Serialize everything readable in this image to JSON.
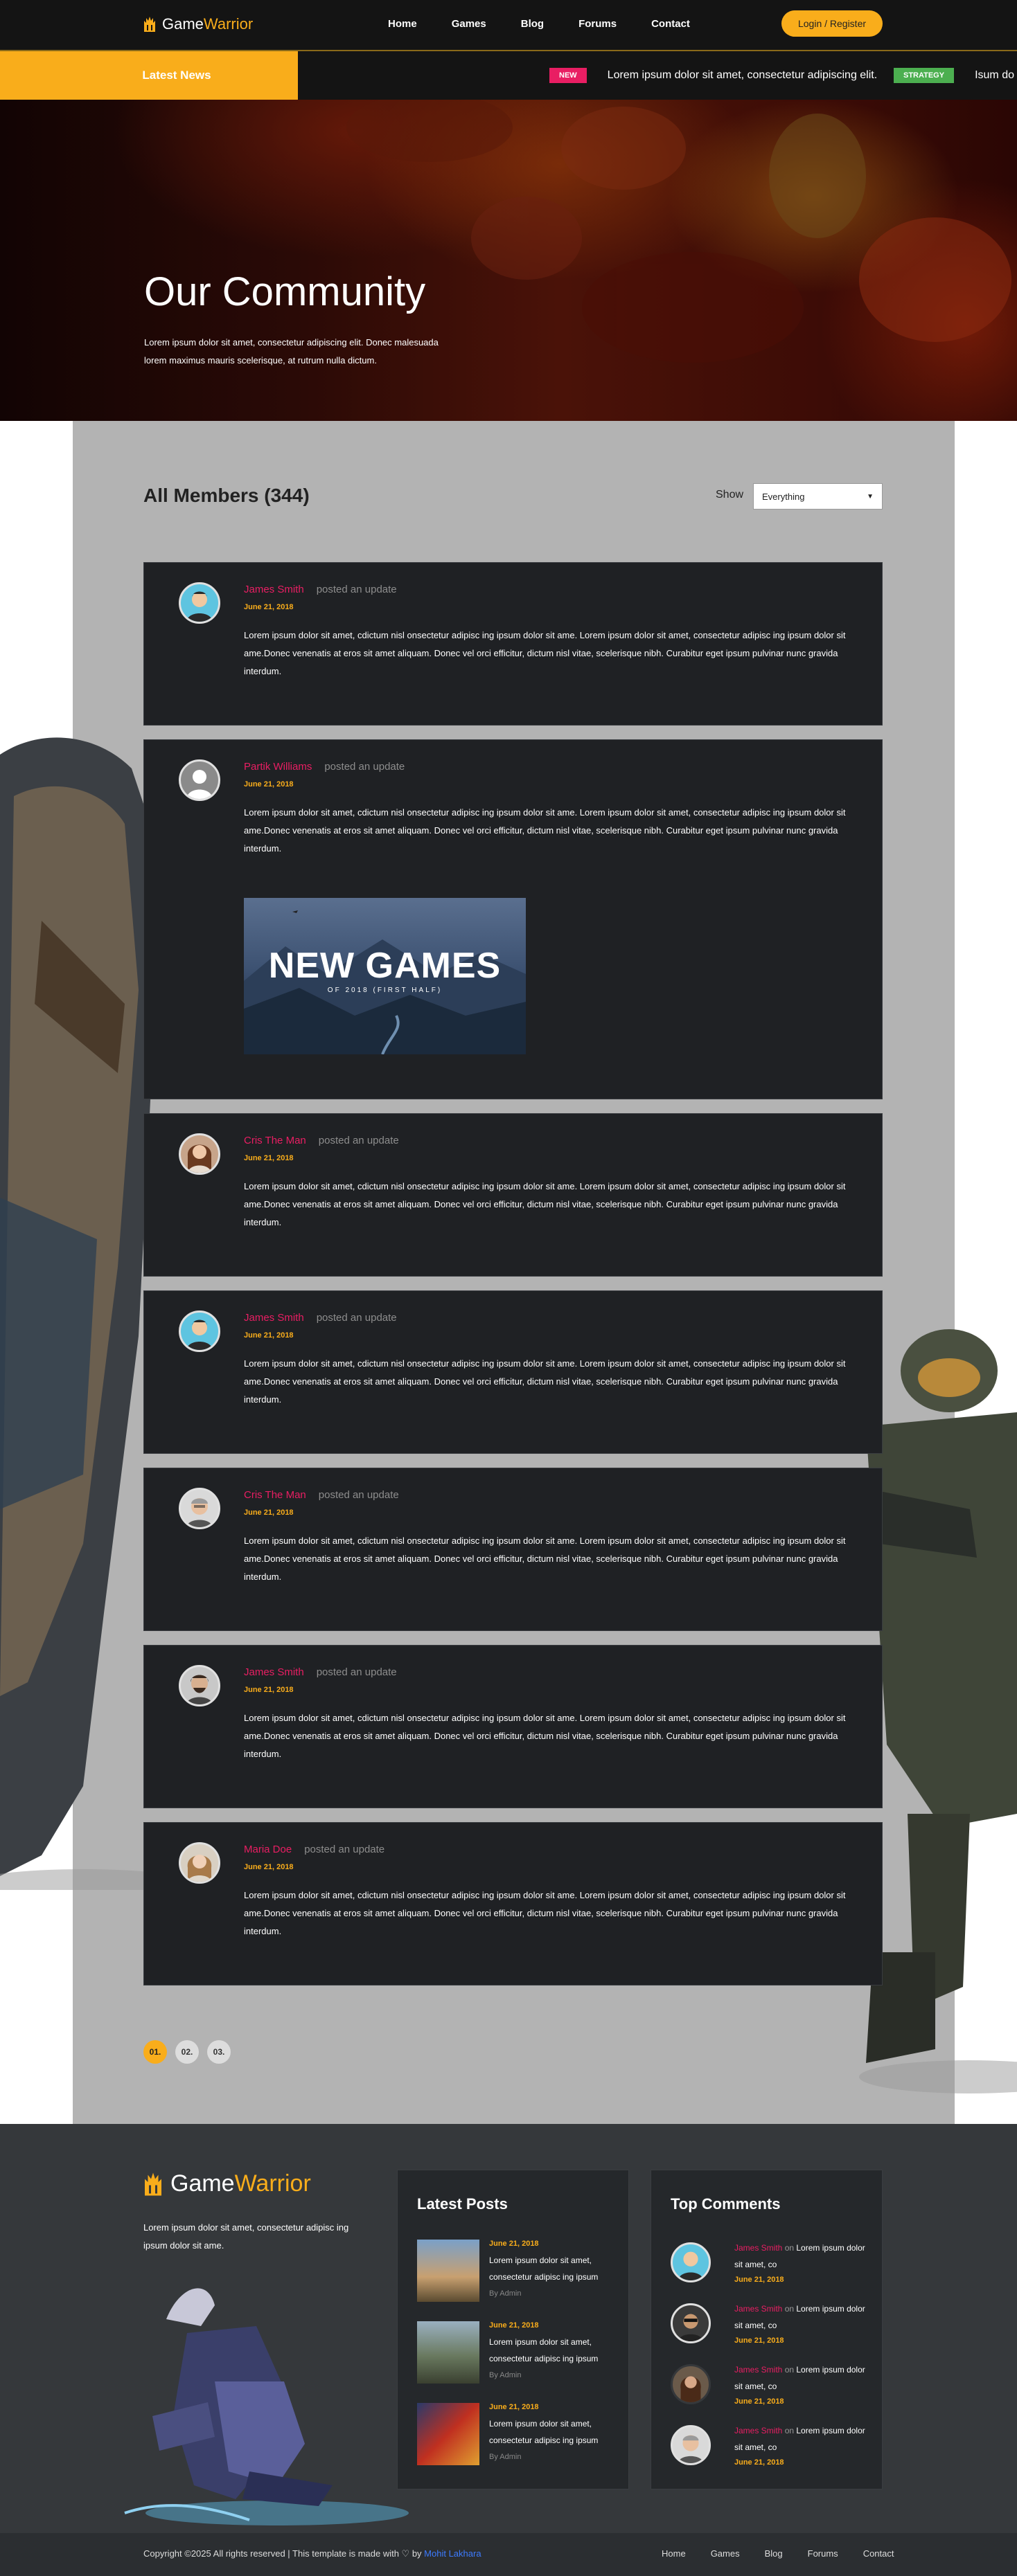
{
  "header": {
    "logo_main": "Game ",
    "logo_accent": "Warrior",
    "nav": [
      "Home",
      "Games",
      "Blog",
      "Forums",
      "Contact"
    ],
    "login_label": "Login / Register"
  },
  "ticker": {
    "label": "Latest News",
    "items": [
      {
        "tag": "NEW",
        "text": "Lorem ipsum dolor sit amet, consectetur adipiscing elit."
      },
      {
        "tag": "STRATEGY",
        "text": "Isum do"
      }
    ]
  },
  "hero": {
    "title": "Our Community",
    "text": "Lorem ipsum dolor sit amet, consectetur adipiscing elit. Donec malesuada lorem maximus mauris scelerisque, at rutrum nulla dictum."
  },
  "members": {
    "title": "All Members (344)",
    "show_label": "Show",
    "show_value": "Everything"
  },
  "posts": [
    {
      "name": "James Smith",
      "action": "posted an update",
      "date": "June 21, 2018",
      "text": "Lorem ipsum dolor sit amet, cdictum nisl onsectetur adipisc ing ipsum dolor sit ame. Lorem ipsum dolor sit amet, consectetur adipisc ing ipsum dolor sit ame.Donec venenatis at eros sit amet aliquam. Donec vel orci efficitur, dictum nisl vitae, scelerisque nibh. Curabitur eget ipsum pulvinar nunc gravida interdum."
    },
    {
      "name": "Partik Williams",
      "action": "posted an update",
      "date": "June 21, 2018",
      "text": "Lorem ipsum dolor sit amet, cdictum nisl onsectetur adipisc ing ipsum dolor sit ame. Lorem ipsum dolor sit amet, consectetur adipisc ing ipsum dolor sit ame.Donec venenatis at eros sit amet aliquam. Donec vel orci efficitur, dictum nisl vitae, scelerisque nibh. Curabitur eget ipsum pulvinar nunc gravida interdum.",
      "image_title": "NEW GAMES",
      "image_subtitle": "OF 2018 (FIRST HALF)"
    },
    {
      "name": "Cris The Man",
      "action": "posted an update",
      "date": "June 21, 2018",
      "text": "Lorem ipsum dolor sit amet, cdictum nisl onsectetur adipisc ing ipsum dolor sit ame. Lorem ipsum dolor sit amet, consectetur adipisc ing ipsum dolor sit ame.Donec venenatis at eros sit amet aliquam. Donec vel orci efficitur, dictum nisl vitae, scelerisque nibh. Curabitur eget ipsum pulvinar nunc gravida interdum."
    },
    {
      "name": "James Smith",
      "action": "posted an update",
      "date": "June 21, 2018",
      "text": "Lorem ipsum dolor sit amet, cdictum nisl onsectetur adipisc ing ipsum dolor sit ame. Lorem ipsum dolor sit amet, consectetur adipisc ing ipsum dolor sit ame.Donec venenatis at eros sit amet aliquam. Donec vel orci efficitur, dictum nisl vitae, scelerisque nibh. Curabitur eget ipsum pulvinar nunc gravida interdum."
    },
    {
      "name": "Cris The Man",
      "action": "posted an update",
      "date": "June 21, 2018",
      "text": "Lorem ipsum dolor sit amet, cdictum nisl onsectetur adipisc ing ipsum dolor sit ame. Lorem ipsum dolor sit amet, consectetur adipisc ing ipsum dolor sit ame.Donec venenatis at eros sit amet aliquam. Donec vel orci efficitur, dictum nisl vitae, scelerisque nibh. Curabitur eget ipsum pulvinar nunc gravida interdum."
    },
    {
      "name": "James Smith",
      "action": "posted an update",
      "date": "June 21, 2018",
      "text": "Lorem ipsum dolor sit amet, cdictum nisl onsectetur adipisc ing ipsum dolor sit ame. Lorem ipsum dolor sit amet, consectetur adipisc ing ipsum dolor sit ame.Donec venenatis at eros sit amet aliquam. Donec vel orci efficitur, dictum nisl vitae, scelerisque nibh. Curabitur eget ipsum pulvinar nunc gravida interdum."
    },
    {
      "name": "Maria Doe",
      "action": "posted an update",
      "date": "June 21, 2018",
      "text": "Lorem ipsum dolor sit amet, cdictum nisl onsectetur adipisc ing ipsum dolor sit ame. Lorem ipsum dolor sit amet, consectetur adipisc ing ipsum dolor sit ame.Donec venenatis at eros sit amet aliquam. Donec vel orci efficitur, dictum nisl vitae, scelerisque nibh. Curabitur eget ipsum pulvinar nunc gravida interdum."
    }
  ],
  "pager": [
    "01.",
    "02.",
    "03."
  ],
  "footer": {
    "logo_main": "Game ",
    "logo_accent": "Warrior",
    "about": "Lorem ipsum dolor sit amet, consectetur adipisc ing ipsum dolor sit ame.",
    "latest_posts_title": "Latest Posts",
    "latest_posts": [
      {
        "date": "June 21, 2018",
        "text": "Lorem ipsum dolor sit amet, consectetur adipisc ing ipsum",
        "by": "By Admin"
      },
      {
        "date": "June 21, 2018",
        "text": "Lorem ipsum dolor sit amet, consectetur adipisc ing ipsum",
        "by": "By Admin"
      },
      {
        "date": "June 21, 2018",
        "text": "Lorem ipsum dolor sit amet, consectetur adipisc ing ipsum",
        "by": "By Admin"
      }
    ],
    "top_comments_title": "Top Comments",
    "top_comments": [
      {
        "name": "James Smith",
        "on": " on ",
        "text": "Lorem ipsum dolor sit amet, co",
        "date": "June 21, 2018"
      },
      {
        "name": "James Smith",
        "on": " on ",
        "text": "Lorem ipsum dolor sit amet, co",
        "date": "June 21, 2018"
      },
      {
        "name": "James Smith",
        "on": " on ",
        "text": "Lorem ipsum dolor sit amet, co",
        "date": "June 21, 2018"
      },
      {
        "name": "James Smith",
        "on": " on ",
        "text": "Lorem ipsum dolor sit amet, co",
        "date": "June 21, 2018"
      }
    ],
    "copyright_text": "Copyright ©2025 All rights reserved | This template is made with ♡ by ",
    "copyright_link": "Mohit Lakhara",
    "bottom_nav": [
      "Home",
      "Games",
      "Blog",
      "Forums",
      "Contact"
    ]
  },
  "colors": {
    "accent": "#f9ad1b",
    "name": "#e91e63",
    "dark": "#1f2124",
    "gray": "#b3b3b3"
  }
}
